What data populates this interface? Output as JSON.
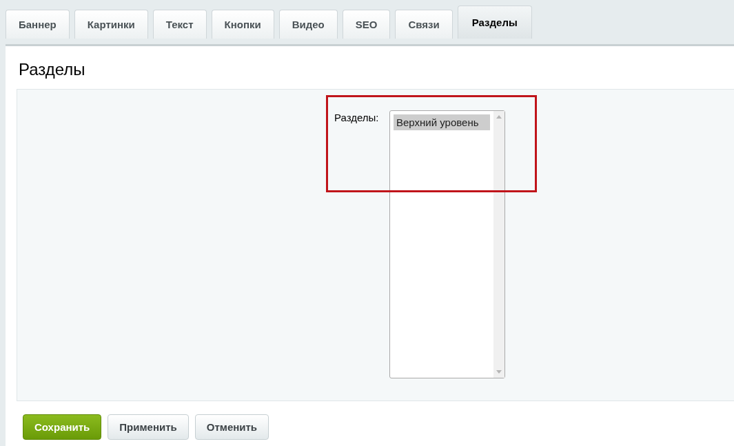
{
  "tabs": [
    {
      "label": "Баннер",
      "selected": false
    },
    {
      "label": "Картинки",
      "selected": false
    },
    {
      "label": "Текст",
      "selected": false
    },
    {
      "label": "Кнопки",
      "selected": false
    },
    {
      "label": "Видео",
      "selected": false
    },
    {
      "label": "SEO",
      "selected": false
    },
    {
      "label": "Связи",
      "selected": false
    },
    {
      "label": "Разделы",
      "selected": true
    }
  ],
  "panel": {
    "title": "Разделы",
    "field": {
      "label": "Разделы:",
      "options": [
        {
          "label": "Верхний уровень",
          "selected": true
        }
      ]
    },
    "highlight": true
  },
  "buttons": [
    {
      "label": "Сохранить",
      "kind": "primary"
    },
    {
      "label": "Применить",
      "kind": "default"
    },
    {
      "label": "Отменить",
      "kind": "default"
    }
  ]
}
